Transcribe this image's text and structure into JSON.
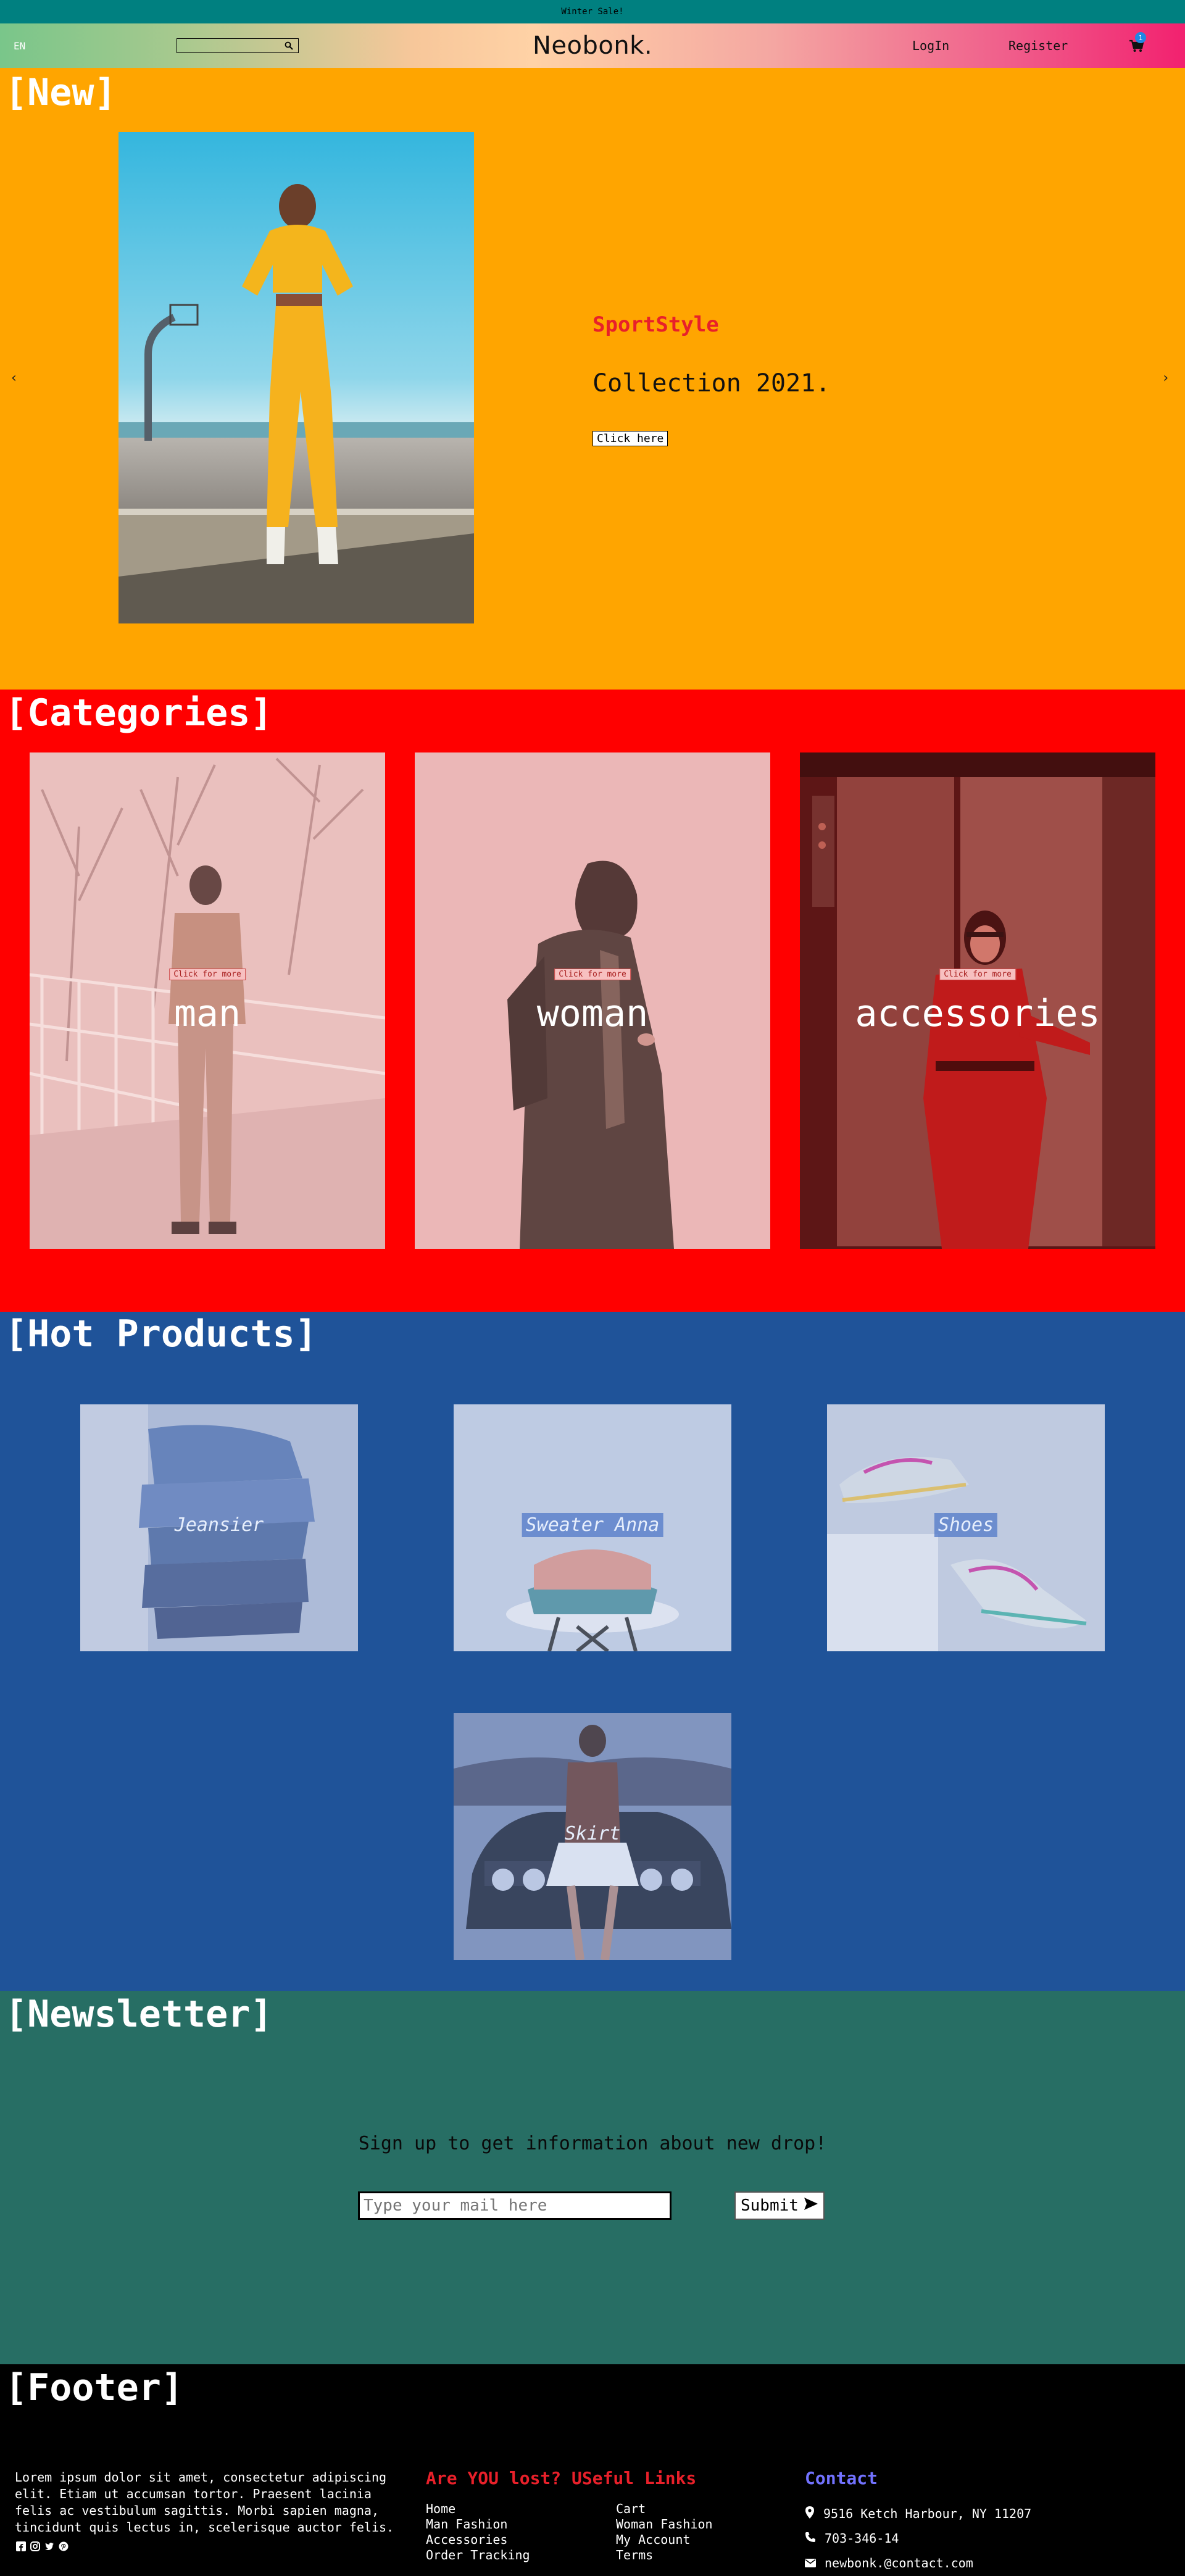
{
  "announcement": "Winter Sale!",
  "navbar": {
    "lang": "EN",
    "search_placeholder": "",
    "brand": "Neobonk.",
    "login": "LogIn",
    "register": "Register",
    "cart_count": "1"
  },
  "new_section": {
    "title": "[New]",
    "prev": "‹",
    "next": "›",
    "brand": "SportStyle",
    "collection": "Collection 2021.",
    "cta": "Click here"
  },
  "categories": {
    "title": "[Categories]",
    "more_label": "Click for more",
    "items": [
      {
        "label": "man"
      },
      {
        "label": "woman"
      },
      {
        "label": "accessories"
      }
    ]
  },
  "hot_products": {
    "title": "[Hot Products]",
    "items": [
      {
        "label": "Jeansier"
      },
      {
        "label": "Sweater Anna"
      },
      {
        "label": "Shoes"
      },
      {
        "label": "Skirt"
      }
    ]
  },
  "newsletter": {
    "title": "[Newsletter]",
    "text": "Sign up to get information about new drop!",
    "input_placeholder": "Type your mail here",
    "submit": "Submit"
  },
  "footer": {
    "title": "[Footer]",
    "about": "Lorem ipsum dolor sit amet, consectetur adipiscing elit. Etiam ut accumsan tortor. Praesent lacinia felis ac vestibulum sagittis. Morbi sapien magna, tincidunt quis lectus in, scelerisque auctor felis.",
    "links_title": "Are YOU lost? USeful Links",
    "links": [
      "Home",
      "Cart",
      "Man Fashion",
      "Woman Fashion",
      "Accessories",
      "My Account",
      "Order Tracking",
      "Terms"
    ],
    "contact_title": "Contact",
    "address": "9516 Ketch Harbour, NY 11207",
    "phone": "703-346-14",
    "email": "newbonk.@contact.com"
  },
  "colors": {
    "topbar": "#008080",
    "new_bg": "#ffa500",
    "categories_bg": "#ff0000",
    "hot_bg": "#1f5399",
    "newsletter_bg": "#276e64",
    "footer_bg": "#000000",
    "accent_red": "#e8202a",
    "contact_blue": "#7272ff"
  }
}
